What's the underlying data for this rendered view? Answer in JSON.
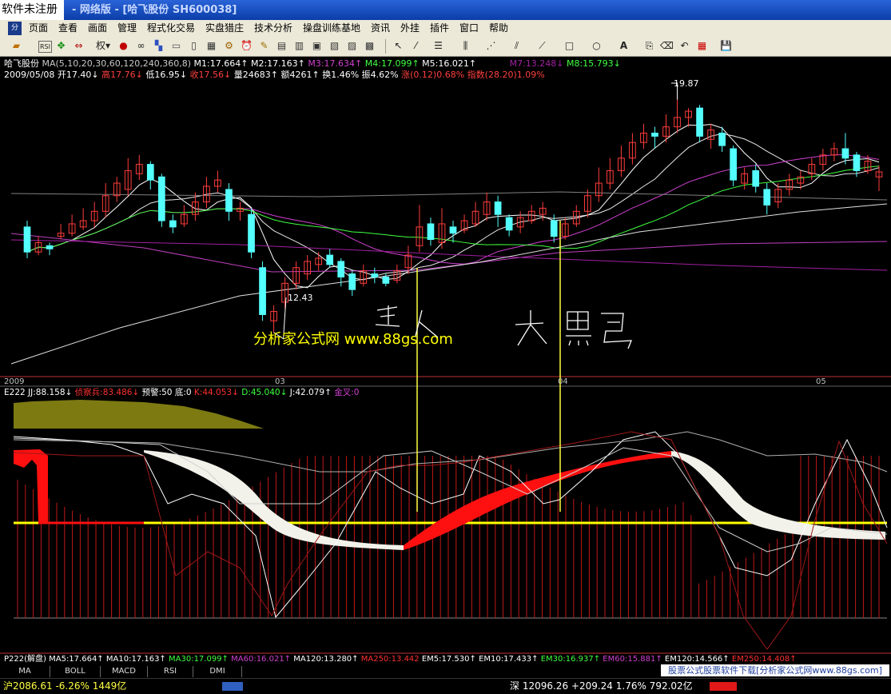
{
  "window": {
    "unregistered": "软件未注册",
    "title": "- 网络版 - [哈飞股份 SH600038]"
  },
  "menu": [
    {
      "label": "页面"
    },
    {
      "label": "查看"
    },
    {
      "label": "画面"
    },
    {
      "label": "管理"
    },
    {
      "label": "程式化交易"
    },
    {
      "label": "实盘猎庄"
    },
    {
      "label": "技术分析"
    },
    {
      "label": "操盘训练基地"
    },
    {
      "label": "资讯"
    },
    {
      "label": "外挂"
    },
    {
      "label": "插件"
    },
    {
      "label": "窗口"
    },
    {
      "label": "帮助"
    }
  ],
  "toolbar": {
    "quan_label": "权"
  },
  "info_line1": {
    "stock": "哈飞股份",
    "ma_def": "MA(5,10,20,30,60,120,240,360,8)",
    "m1": "M1:17.664↑",
    "m2": "M2:17.163↑",
    "m3": "M3:17.634↑",
    "m4": "M4:17.099↑",
    "m5": "M5:16.021↑",
    "m7": "M7:13.248↓",
    "m8": "M8:15.793↓"
  },
  "info_line2": {
    "date": "2009/05/08",
    "open": "开17.40↓",
    "high": "高17.76↓",
    "low": "低16.95↓",
    "close": "收17.56↓",
    "volume": "量24683↑",
    "amount": "额4261↑",
    "turnover": "换1.46%",
    "amplitude": "振4.62%",
    "change": "涨(0.12)0.68%",
    "index": "指数(28.20)1.09%"
  },
  "annotations": {
    "high_label": "19.87",
    "low_label": "12.43",
    "watermark": "分析家公式网 www.88gs.com",
    "hand_text_1": "买入",
    "hand_text_2": "大黑马"
  },
  "date_axis": {
    "d1": "2009",
    "d2": "03",
    "d3": "04",
    "d4": "05"
  },
  "indicator1": {
    "name": "E222",
    "jj": "JJ:88.158↓",
    "zhen": "侦察兵:83.486↓",
    "warn": "预警:50",
    "bottom": "底:0",
    "k": "K:44.053↓",
    "d": "D:45.040↓",
    "j": "J:42.079↑",
    "gold": "金叉:0"
  },
  "indicator2": {
    "name": "P222(解盘)",
    "ma5": "MA5:17.664↑",
    "ma10": "MA10:17.163↑",
    "ma30": "MA30:17.099↑",
    "ma60": "MA60:16.021↑",
    "ma120": "MA120:13.280↑",
    "ma250": "MA250:13.442",
    "em5": "EM5:17.530↑",
    "em10": "EM10:17.433↑",
    "em30": "EM30:16.937↑",
    "em60": "EM60:15.881↑",
    "em120": "EM120:14.566↑",
    "em250": "EM250:14.408↑"
  },
  "bottom_tabs": [
    "MA",
    "BOLL",
    "MACD",
    "RSI",
    "DMI"
  ],
  "ad_text": "股票公式股票软件下载[分析家公式网www.88gs.com]",
  "status": {
    "left": "沪2086.61 -6.26% 1449亿",
    "right": "深 12096.26 +209.24 1.76% 792.02亿"
  },
  "colors": {
    "up": "#ff3c3c",
    "down": "#54ffff",
    "watermark": "#ffff00",
    "white_ribbon": "#f2f2ea",
    "red_ribbon": "#ff1010",
    "olive_area": "#7d7a12"
  },
  "chart_data": {
    "type": "candlestick",
    "candles": [
      [
        15.8,
        15.0,
        16.0,
        14.8
      ],
      [
        15.0,
        15.3,
        15.5,
        14.9
      ],
      [
        15.2,
        15.1,
        15.3,
        14.9
      ],
      [
        15.5,
        15.6,
        15.9,
        15.4
      ],
      [
        15.6,
        15.9,
        16.2,
        15.5
      ],
      [
        15.8,
        16.0,
        16.4,
        15.7
      ],
      [
        16.0,
        16.3,
        16.6,
        15.8
      ],
      [
        16.3,
        16.8,
        17.2,
        16.1
      ],
      [
        16.8,
        17.2,
        17.4,
        16.6
      ],
      [
        17.0,
        17.6,
        18.0,
        16.8
      ],
      [
        17.5,
        17.8,
        18.1,
        17.3
      ],
      [
        17.8,
        17.3,
        17.9,
        17.0
      ],
      [
        17.4,
        16.0,
        17.5,
        15.8
      ],
      [
        16.0,
        15.8,
        16.2,
        15.6
      ],
      [
        15.9,
        16.2,
        16.5,
        15.8
      ],
      [
        16.2,
        16.6,
        16.9,
        16.0
      ],
      [
        16.6,
        17.1,
        17.4,
        16.4
      ],
      [
        17.1,
        17.3,
        17.6,
        16.9
      ],
      [
        17.0,
        16.3,
        17.2,
        16.0
      ],
      [
        16.3,
        16.4,
        16.6,
        16.0
      ],
      [
        16.2,
        15.0,
        16.4,
        14.8
      ],
      [
        14.5,
        13.0,
        14.7,
        12.8
      ],
      [
        12.8,
        13.1,
        13.3,
        12.43
      ],
      [
        13.4,
        14.0,
        14.2,
        13.2
      ],
      [
        14.0,
        14.5,
        14.7,
        13.8
      ],
      [
        14.3,
        14.7,
        14.9,
        14.1
      ],
      [
        14.6,
        14.8,
        15.0,
        14.4
      ],
      [
        14.9,
        14.6,
        15.1,
        14.5
      ],
      [
        14.7,
        14.2,
        14.8,
        13.9
      ],
      [
        14.3,
        13.8,
        14.4,
        13.6
      ],
      [
        14.0,
        14.4,
        14.6,
        13.9
      ],
      [
        14.3,
        14.2,
        14.5,
        14.0
      ],
      [
        14.2,
        14.0,
        14.3,
        13.9
      ],
      [
        14.1,
        14.4,
        14.6,
        14.0
      ],
      [
        14.5,
        14.9,
        15.2,
        14.3
      ],
      [
        15.2,
        15.8,
        16.5,
        15.0
      ],
      [
        15.9,
        15.4,
        16.1,
        15.2
      ],
      [
        15.3,
        15.9,
        16.4,
        15.1
      ],
      [
        15.8,
        15.6,
        16.0,
        15.3
      ],
      [
        15.7,
        16.0,
        16.2,
        15.6
      ],
      [
        15.9,
        16.3,
        16.6,
        15.8
      ],
      [
        16.2,
        16.6,
        16.9,
        16.0
      ],
      [
        16.6,
        16.2,
        16.8,
        15.8
      ],
      [
        16.1,
        15.7,
        16.2,
        15.5
      ],
      [
        15.8,
        16.1,
        16.3,
        15.6
      ],
      [
        16.0,
        16.3,
        16.5,
        15.9
      ],
      [
        16.2,
        16.4,
        16.6,
        16.0
      ],
      [
        16.0,
        15.5,
        16.2,
        15.3
      ],
      [
        15.5,
        15.9,
        16.1,
        15.4
      ],
      [
        15.9,
        16.3,
        16.5,
        15.8
      ],
      [
        16.3,
        16.8,
        17.0,
        16.1
      ],
      [
        16.8,
        17.2,
        17.7,
        16.6
      ],
      [
        17.2,
        17.6,
        18.0,
        17.0
      ],
      [
        17.6,
        18.0,
        18.4,
        17.4
      ],
      [
        18.0,
        18.5,
        18.8,
        17.8
      ],
      [
        18.5,
        18.8,
        19.1,
        18.3
      ],
      [
        18.8,
        18.7,
        19.0,
        18.3
      ],
      [
        18.7,
        19.0,
        19.4,
        18.5
      ],
      [
        19.0,
        19.3,
        19.87,
        18.8
      ],
      [
        19.3,
        19.5,
        19.6,
        19.0
      ],
      [
        19.6,
        18.7,
        19.7,
        18.5
      ],
      [
        18.6,
        18.9,
        19.1,
        18.3
      ],
      [
        18.8,
        18.4,
        19.0,
        18.2
      ],
      [
        18.3,
        17.3,
        18.4,
        17.1
      ],
      [
        17.2,
        17.5,
        17.7,
        17.0
      ],
      [
        17.6,
        17.1,
        17.8,
        16.9
      ],
      [
        17.0,
        16.5,
        17.2,
        16.2
      ],
      [
        16.6,
        17.0,
        17.2,
        16.4
      ],
      [
        17.0,
        17.3,
        17.5,
        16.8
      ],
      [
        17.2,
        17.4,
        17.6,
        17.0
      ],
      [
        17.5,
        17.8,
        18.0,
        17.3
      ],
      [
        17.8,
        18.1,
        18.3,
        17.6
      ],
      [
        18.1,
        18.3,
        18.5,
        17.9
      ],
      [
        18.3,
        18.0,
        18.8,
        17.8
      ],
      [
        18.1,
        17.6,
        18.2,
        17.4
      ],
      [
        17.6,
        17.9,
        18.1,
        17.5
      ],
      [
        17.4,
        17.56,
        17.76,
        16.95
      ]
    ],
    "price_range": [
      11.3,
      20.6
    ],
    "x_labels": [
      "2009",
      "03",
      "04",
      "05"
    ],
    "signal_lines": [
      {
        "label": "买入",
        "candle_index": 38
      },
      {
        "label": "大黑马",
        "candle_index": 52
      }
    ]
  }
}
